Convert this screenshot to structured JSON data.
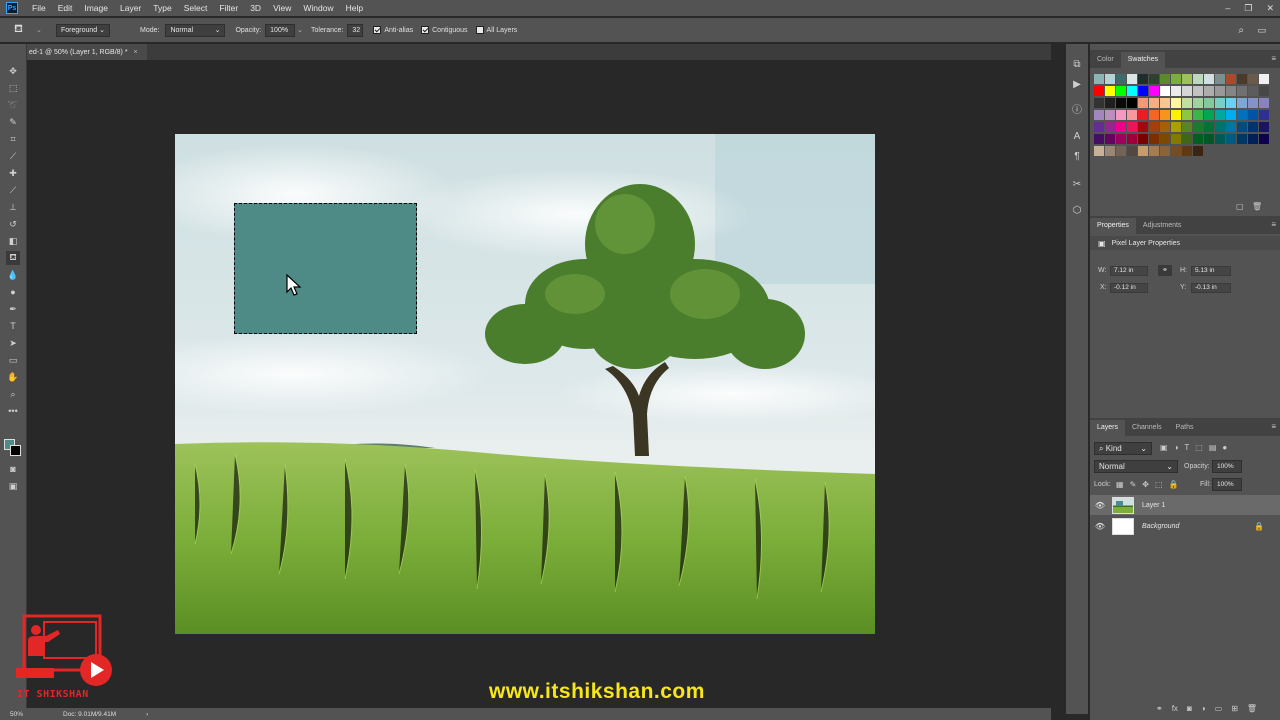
{
  "menubar": {
    "logo": "Ps",
    "items": [
      "File",
      "Edit",
      "Image",
      "Layer",
      "Type",
      "Select",
      "Filter",
      "3D",
      "View",
      "Window",
      "Help"
    ]
  },
  "options": {
    "fill_source": "Foreground",
    "mode_label": "Mode:",
    "mode_value": "Normal",
    "opacity_label": "Opacity:",
    "opacity_value": "100%",
    "tolerance_label": "Tolerance:",
    "tolerance_value": "32",
    "anti_alias": "Anti-alias",
    "contiguous": "Contiguous",
    "all_layers": "All Layers"
  },
  "document": {
    "tab_title": "ed-1 @ 50% (Layer 1, RGB/8) *",
    "tab_close": "×"
  },
  "status": {
    "zoom": "50%",
    "doc": "Doc: 9.01M/9.41M",
    "arrow": "›"
  },
  "color_panel": {
    "tabs": [
      "Color",
      "Swatches"
    ],
    "active": "Swatches"
  },
  "properties_panel": {
    "tabs": [
      "Properties",
      "Adjustments"
    ],
    "title": "Pixel Layer Properties",
    "w_label": "W:",
    "w_value": "7.12 in",
    "h_label": "H:",
    "h_value": "5.13 in",
    "x_label": "X:",
    "x_value": "-0.12 in",
    "y_label": "Y:",
    "y_value": "-0.13 in"
  },
  "layers_panel": {
    "tabs": [
      "Layers",
      "Channels",
      "Paths"
    ],
    "kind": "Kind",
    "blend": "Normal",
    "opacity_label": "Opacity:",
    "opacity_value": "100%",
    "lock_label": "Lock:",
    "fill_label": "Fill:",
    "fill_value": "100%",
    "layers": [
      {
        "name": "Layer 1",
        "selected": true
      },
      {
        "name": "Background",
        "selected": false
      }
    ]
  },
  "watermark": {
    "brand": "IT SHIKSHAN",
    "url": "www.itshikshan.com"
  },
  "colors": {
    "selection_fill": "#4e8a86",
    "foreground": "#4e8a86",
    "ui_panel": "#535353",
    "accent_url": "#f6e61a"
  }
}
